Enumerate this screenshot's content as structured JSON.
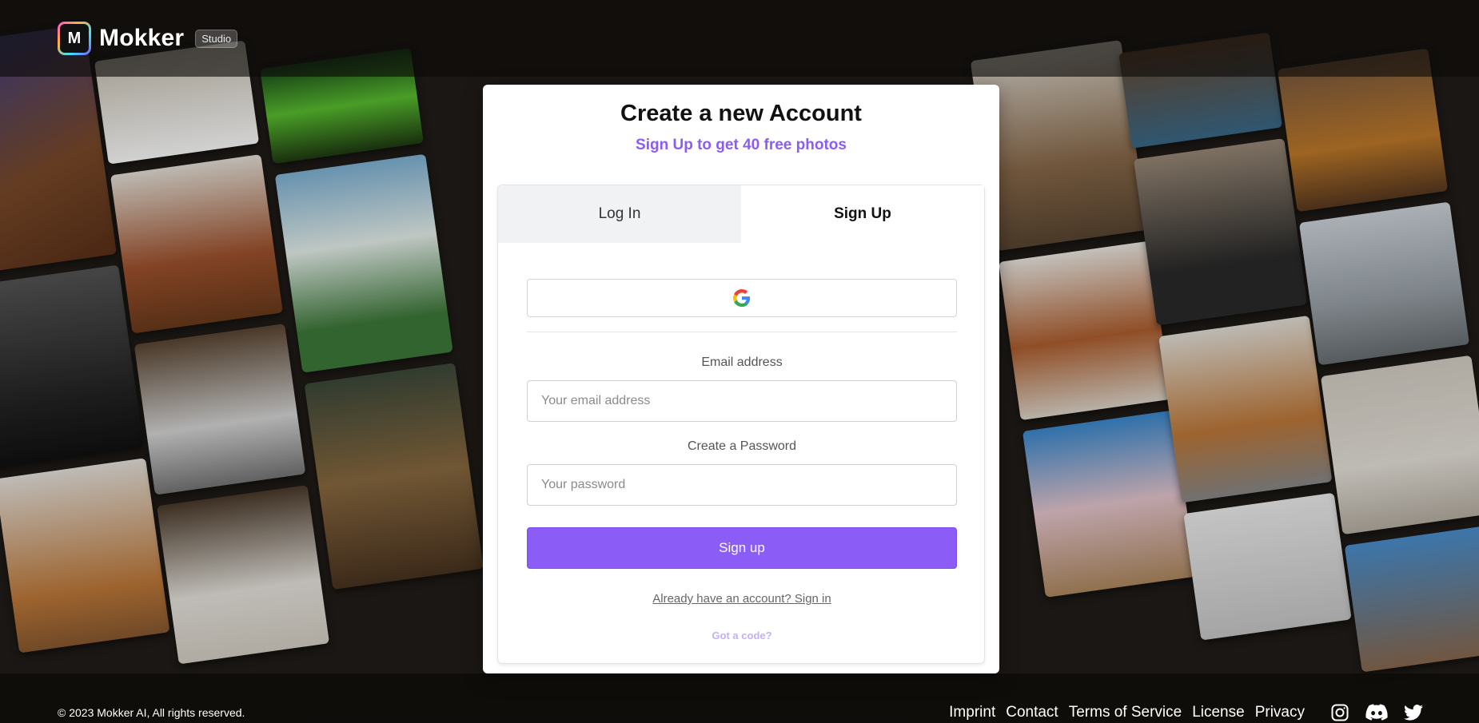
{
  "header": {
    "logo_letter": "M",
    "brand": "Mokker",
    "badge": "Studio"
  },
  "card": {
    "title": "Create a new Account",
    "subtitle": "Sign Up to get 40 free photos",
    "tabs": [
      {
        "label": "Log In",
        "active": false
      },
      {
        "label": "Sign Up",
        "active": true
      }
    ],
    "email": {
      "label": "Email address",
      "placeholder": "Your email address",
      "value": ""
    },
    "password": {
      "label": "Create a Password",
      "placeholder": "Your password",
      "value": ""
    },
    "submit_label": "Sign up",
    "signin_link": "Already have an account? Sign in",
    "code_link": "Got a code?"
  },
  "footer": {
    "copyright": "© 2023 Mokker AI, All rights reserved.",
    "links": [
      "Imprint",
      "Contact",
      "Terms of Service",
      "License",
      "Privacy"
    ],
    "social_icons": [
      "instagram-icon",
      "discord-icon",
      "twitter-icon"
    ]
  },
  "colors": {
    "accent": "#8b5cf6",
    "accent_light": "#c4b0f7"
  }
}
